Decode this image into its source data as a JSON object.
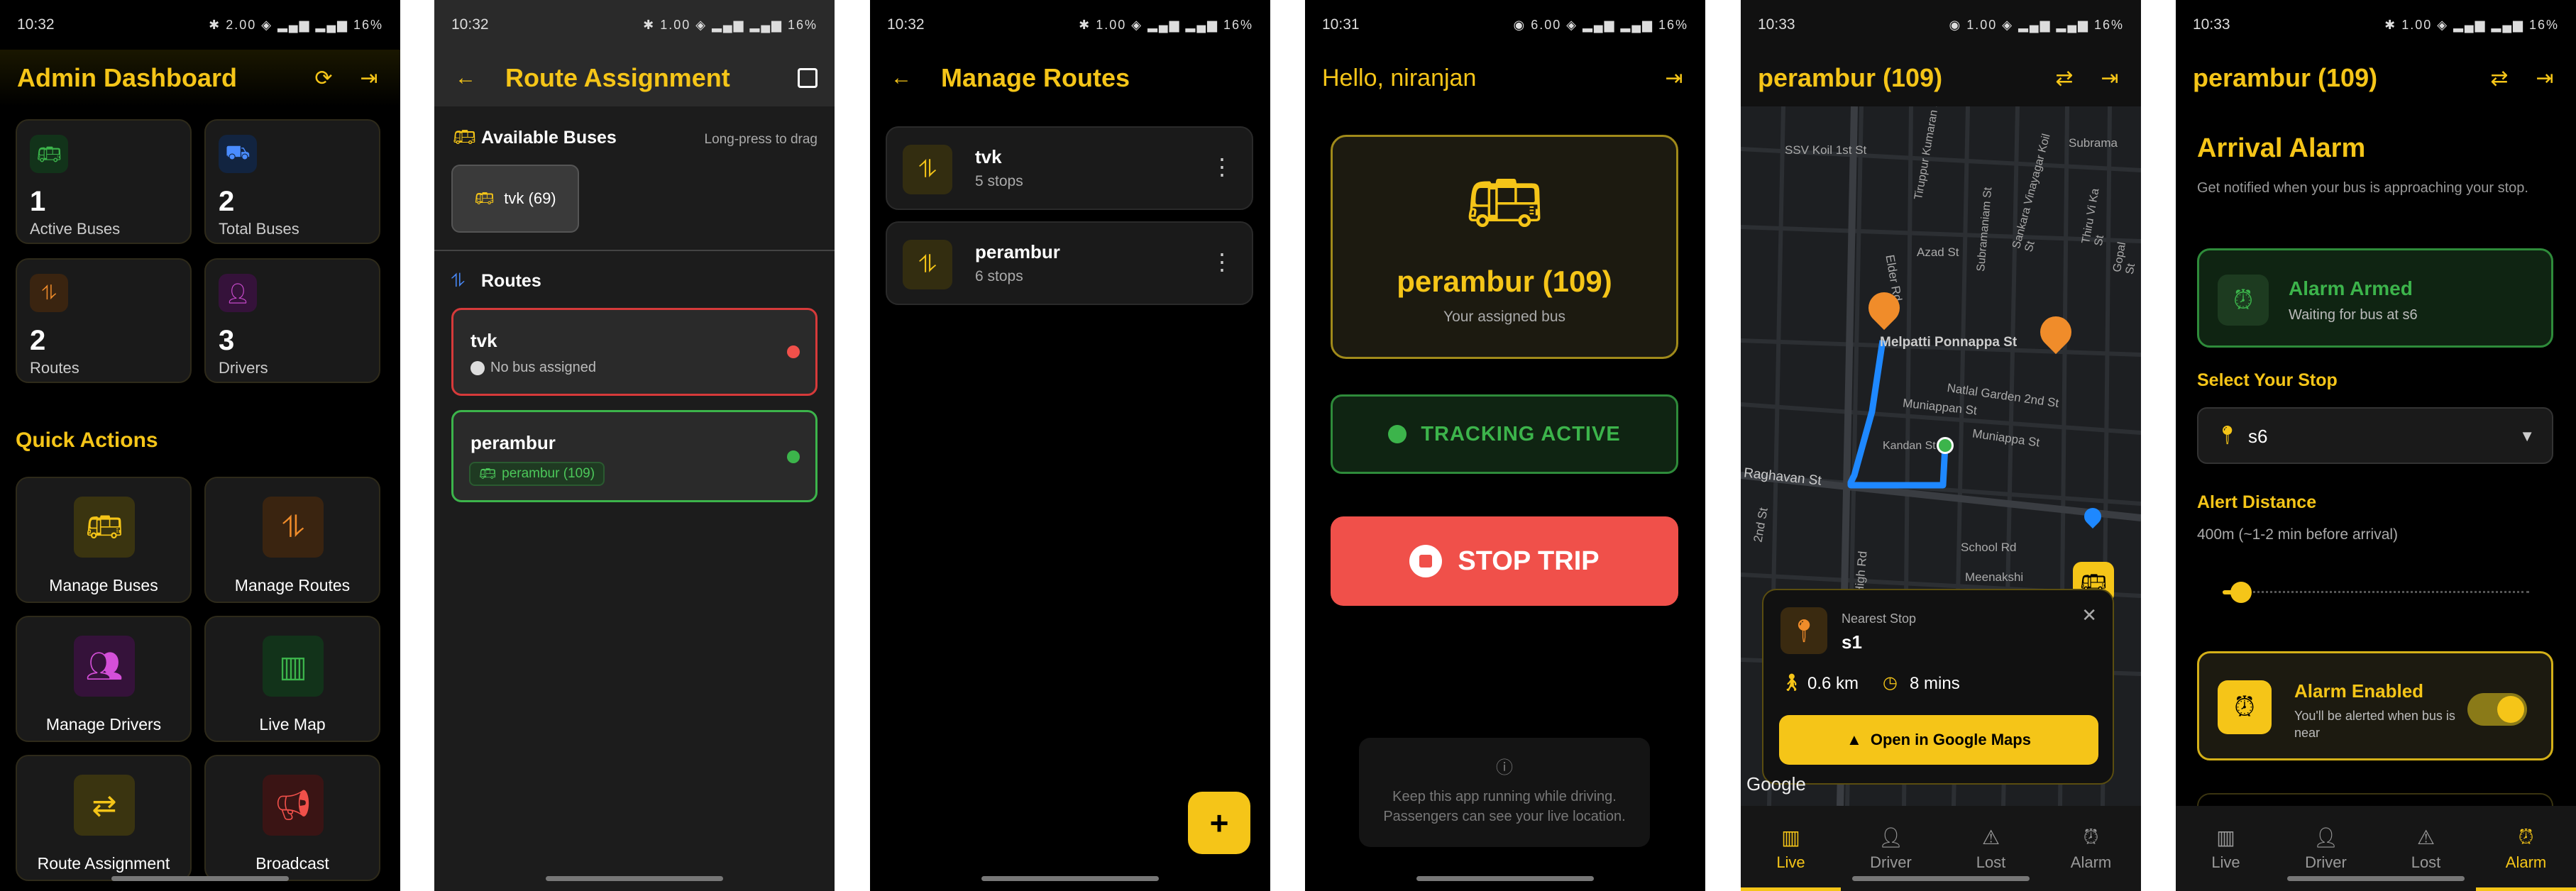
{
  "colors": {
    "accent": "#f5c518",
    "bg": "#000000",
    "card": "#1a1a1a",
    "danger": "#f0504a",
    "success": "#3cb44b",
    "route_line": "#1e88ff"
  },
  "screens": [
    {
      "status": {
        "time": "10:32",
        "icons": "✱ 2.00 ◈ ▂▄▆ ▂▄▆ 16%"
      },
      "header": {
        "title": "Admin Dashboard"
      },
      "stats": [
        {
          "value": "1",
          "label": "Active Buses"
        },
        {
          "value": "2",
          "label": "Total Buses"
        },
        {
          "value": "2",
          "label": "Routes"
        },
        {
          "value": "3",
          "label": "Drivers"
        }
      ],
      "quick_actions_title": "Quick Actions",
      "actions": [
        {
          "label": "Manage Buses"
        },
        {
          "label": "Manage Routes"
        },
        {
          "label": "Manage Drivers"
        },
        {
          "label": "Live Map"
        },
        {
          "label": "Route Assignment"
        },
        {
          "label": "Broadcast"
        }
      ]
    },
    {
      "status": {
        "time": "10:32",
        "icons": "✱ 1.00 ◈ ▂▄▆ ▂▄▆ 16%"
      },
      "header": {
        "title": "Route Assignment"
      },
      "available_title": "Available Buses",
      "hint": "Long-press to drag",
      "bus_chip": "tvk (69)",
      "routes_title": "Routes",
      "routes": [
        {
          "name": "tvk",
          "sub": "No bus assigned"
        },
        {
          "name": "perambur",
          "chip": "perambur (109)"
        }
      ]
    },
    {
      "status": {
        "time": "10:32",
        "icons": "✱ 1.00 ◈ ▂▄▆ ▂▄▆ 16%"
      },
      "header": {
        "title": "Manage Routes"
      },
      "routes": [
        {
          "name": "tvk",
          "stops": "5 stops"
        },
        {
          "name": "perambur",
          "stops": "6 stops"
        }
      ],
      "fab": "+"
    },
    {
      "status": {
        "time": "10:31",
        "icons": "◉ 6.00 ◈ ▂▄▆ ▂▄▆ 16%"
      },
      "header": {
        "greeting": "Hello, niranjan"
      },
      "bus_name": "perambur (109)",
      "bus_sub": "Your assigned bus",
      "tracking": "TRACKING ACTIVE",
      "stop_trip": "STOP TRIP",
      "info_line1": "Keep this app running while driving.",
      "info_line2": "Passengers can see your live location."
    },
    {
      "status": {
        "time": "10:33",
        "icons": "◉ 1.00 ◈ ▂▄▆ ▂▄▆ 16%"
      },
      "header": {
        "title": "perambur  (109)"
      },
      "map_labels": [
        "SSV Koil 1st St",
        "Subrama",
        "Azad St",
        "Elder Rd",
        "Melpatti Ponnappa St",
        "Natlal Garden 2nd St",
        "Muniappan St",
        "Muniappa St",
        "Kandan St",
        "Raghavan St",
        "2nd St",
        "School Rd",
        "Meenakshi",
        "Tiruppur Kumaran St",
        "Sankara Vinayagar Koil St",
        "Thiru Vi Ka St",
        "Gopal St",
        "Subramaniam St",
        "Dhavaram High Rd"
      ],
      "popup": {
        "label": "Nearest Stop",
        "stop": "s1",
        "distance": "0.6 km",
        "time": "8 mins",
        "button": "Open in Google Maps"
      },
      "google": "Google",
      "nav": [
        "Live",
        "Driver",
        "Lost",
        "Alarm"
      ]
    },
    {
      "status": {
        "time": "10:33",
        "icons": "✱ 1.00 ◈ ▂▄▆ ▂▄▆ 16%"
      },
      "header": {
        "title": "perambur  (109)"
      },
      "heading": "Arrival Alarm",
      "subtitle": "Get notified when your bus is approaching your stop.",
      "armed_title": "Alarm Armed",
      "armed_sub": "Waiting for bus at s6",
      "select_label": "Select Your Stop",
      "select_value": "s6",
      "distance_label": "Alert Distance",
      "distance_value": "400m (~1-2 min before arrival)",
      "distance_slider": 0.06,
      "enabled_title": "Alarm Enabled",
      "enabled_sub": "You'll be alerted when bus is near",
      "nav": [
        "Live",
        "Driver",
        "Lost",
        "Alarm"
      ]
    }
  ]
}
